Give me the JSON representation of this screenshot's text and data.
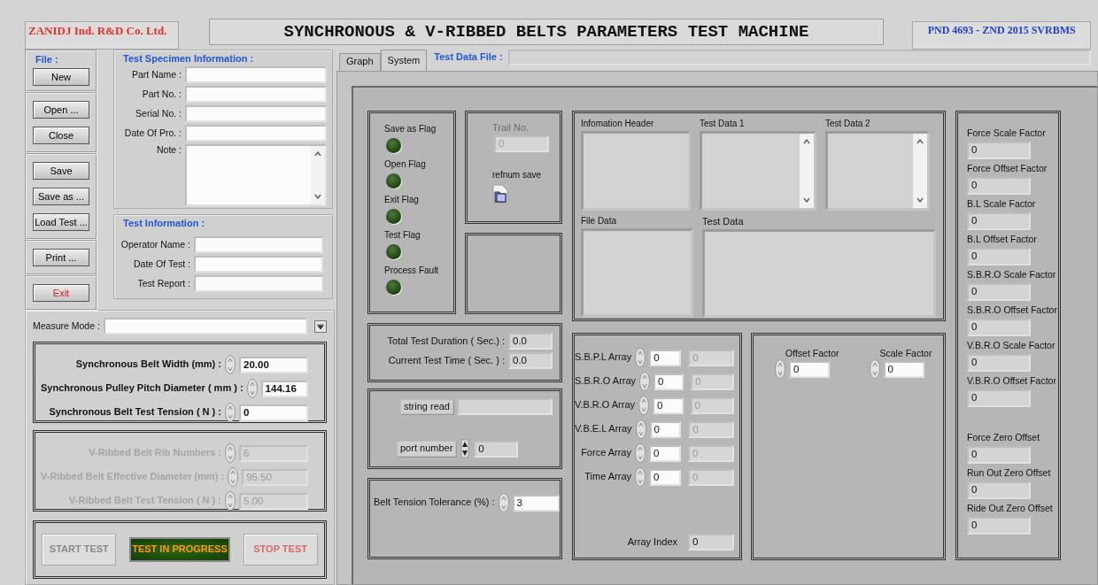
{
  "header": {
    "company": "ZANIDJ Ind. R&D Co. Ltd.",
    "title": "SYNCHRONOUS & V-RIBBED BELTS PARAMETERS TEST MACHINE",
    "code": "PND 4693 - ZND 2015 SVRBMS"
  },
  "file_panel": {
    "label": "File :",
    "groups": [
      [
        {
          "label": "New",
          "kind": "normal"
        }
      ],
      [
        {
          "label": "Open ...",
          "kind": "normal"
        },
        {
          "label": "Close",
          "kind": "normal"
        }
      ],
      [
        {
          "label": "Save",
          "kind": "normal"
        },
        {
          "label": "Save as ...",
          "kind": "normal"
        },
        {
          "label": "Load Test ...",
          "kind": "normal"
        }
      ],
      [
        {
          "label": "Print ...",
          "kind": "normal"
        }
      ],
      [
        {
          "label": "Exit",
          "kind": "danger"
        }
      ]
    ]
  },
  "specimen": {
    "title": "Test Specimen Information :",
    "fields": [
      {
        "label": "Part Name :",
        "kind": "text"
      },
      {
        "label": "Part No. :",
        "kind": "text"
      },
      {
        "label": "Serial No. :",
        "kind": "text"
      },
      {
        "label": "Date Of Pro. :",
        "kind": "text"
      },
      {
        "label": "Note :",
        "kind": "textarea"
      }
    ]
  },
  "test_info": {
    "title": "Test Information :",
    "fields": [
      {
        "label": "Operator Name :"
      },
      {
        "label": "Date Of Test :"
      },
      {
        "label": "Test  Report :"
      }
    ]
  },
  "measure_mode": {
    "label": "Measure Mode :"
  },
  "param_groups": [
    {
      "disabled": false,
      "params": [
        {
          "label": "Synchronous Belt Width (mm) :",
          "value": "20.00"
        },
        {
          "label": "Synchronous Pulley Pitch Diameter ( mm ) :",
          "value": "144.16"
        },
        {
          "label": "Synchronous Belt Test Tension ( N ) :",
          "value": "0"
        }
      ]
    },
    {
      "disabled": true,
      "params": [
        {
          "label": "V-Ribbed Belt Rib Numbers :",
          "value": "6"
        },
        {
          "label": "V-Ribbed Belt Effective Diameter (mm) :",
          "value": "95.50"
        },
        {
          "label": "V-Ribbed Belt Test Tension ( N ) :",
          "value": "5.00"
        }
      ]
    }
  ],
  "actions": [
    {
      "label": "START TEST",
      "kind": "start",
      "disabled": true
    },
    {
      "label": "TEST IN PROGRESS",
      "kind": "indicator",
      "on": true
    },
    {
      "label": "STOP TEST",
      "kind": "stop",
      "disabled": true
    }
  ],
  "tabs": [
    {
      "label": "Graph",
      "selected": false
    },
    {
      "label": "System",
      "selected": true
    }
  ],
  "test_data_file": {
    "label": "Test Data File :"
  },
  "flags": [
    {
      "label": "Save as Flag",
      "on": false
    },
    {
      "label": "Open Flag",
      "on": false
    },
    {
      "label": "Exit Flag",
      "on": false
    },
    {
      "label": "Test Flag",
      "on": false
    },
    {
      "label": "Process Fault",
      "on": false
    }
  ],
  "trail": {
    "label": "Trail No.",
    "value": "0",
    "disabled": true
  },
  "refnum": {
    "label": "refnum save"
  },
  "data_displays": {
    "top": [
      {
        "label": "Infomation Header",
        "scrollbar": false
      },
      {
        "label": "Test Data 1",
        "scrollbar": true
      },
      {
        "label": "Test Data 2",
        "scrollbar": true
      }
    ],
    "bottom": [
      {
        "label": "File Data",
        "scrollbar": false
      },
      {
        "label": "Test Data",
        "scrollbar": false
      }
    ]
  },
  "durations": [
    {
      "label": "Total Test Duration (  Sec.) :",
      "value": "0.0"
    },
    {
      "label": "Current Test Time ( Sec. ) :",
      "value": "0.0"
    }
  ],
  "serial": {
    "string_read": {
      "label": "string read"
    },
    "port_number": {
      "label": "port number",
      "value": "0"
    }
  },
  "tolerance": {
    "label": "Belt Tension Tolerance (%) :",
    "value": "3"
  },
  "arrays": [
    {
      "label": "S.B.P.L Array",
      "index": "0",
      "element": "0"
    },
    {
      "label": "S.B.R.O Array",
      "index": "0",
      "element": "0"
    },
    {
      "label": "V.B.R.O Array",
      "index": "0",
      "element": "0"
    },
    {
      "label": "V.B.E.L Array",
      "index": "0",
      "element": "0"
    },
    {
      "label": "Force Array",
      "index": "0",
      "element": "0"
    },
    {
      "label": "Time Array",
      "index": "0",
      "element": "0"
    }
  ],
  "array_index": {
    "label": "Array Index",
    "value": "0"
  },
  "factors": [
    {
      "label": "Offset Factor",
      "value": "0"
    },
    {
      "label": "Scale Factor",
      "value": "0"
    }
  ],
  "calibration": [
    [
      {
        "label": "Force Scale Factor",
        "value": "0"
      },
      {
        "label": "Force Offset Factor",
        "value": "0"
      },
      {
        "label": "B.L Scale Factor",
        "value": "0"
      },
      {
        "label": "B.L Offset Factor",
        "value": "0"
      },
      {
        "label": "S.B.R.O Scale Factor",
        "value": "0"
      },
      {
        "label": "S.B.R.O Offset Factor",
        "value": "0"
      },
      {
        "label": "V.B.R.O Scale Factor",
        "value": "0"
      },
      {
        "label": "V.B.R.O Offset Factor",
        "value": "0"
      }
    ],
    [
      {
        "label": "Force Zero Offset",
        "value": "0"
      },
      {
        "label": "Run Out Zero Offset",
        "value": "0"
      },
      {
        "label": "Ride Out Zero Offset",
        "value": "0"
      }
    ]
  ]
}
